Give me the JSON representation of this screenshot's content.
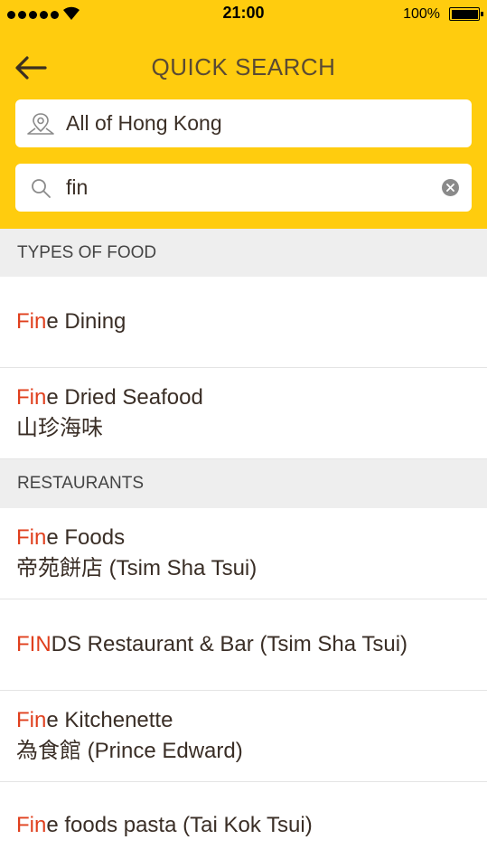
{
  "status_bar": {
    "time": "21:00",
    "battery": "100%"
  },
  "header": {
    "title": "QUICK SEARCH"
  },
  "location": {
    "label": "All of Hong Kong"
  },
  "search": {
    "value": "fin"
  },
  "sections": [
    {
      "title": "TYPES OF FOOD",
      "items": [
        {
          "match": "Fin",
          "rest": "e Dining",
          "sub": ""
        },
        {
          "match": "Fin",
          "rest": "e Dried Seafood",
          "sub": "山珍海味"
        }
      ]
    },
    {
      "title": "RESTAURANTS",
      "items": [
        {
          "match": "Fin",
          "rest": "e Foods",
          "sub": "帝苑餅店 (Tsim Sha Tsui)"
        },
        {
          "match": "FIN",
          "rest": "DS Restaurant & Bar (Tsim Sha Tsui)",
          "sub": ""
        },
        {
          "match": "Fin",
          "rest": "e Kitchenette",
          "sub": "為食館 (Prince Edward)"
        },
        {
          "match": "Fin",
          "rest": "e foods pasta (Tai Kok Tsui)",
          "sub": ""
        }
      ]
    }
  ],
  "colors": {
    "header_bg": "#FFCC0E",
    "highlight": "#E0401E",
    "section_bg": "#EEEEEE"
  },
  "icons": [
    "back-arrow-icon",
    "location-pin-icon",
    "search-icon",
    "clear-icon",
    "wifi-icon",
    "battery-icon"
  ]
}
